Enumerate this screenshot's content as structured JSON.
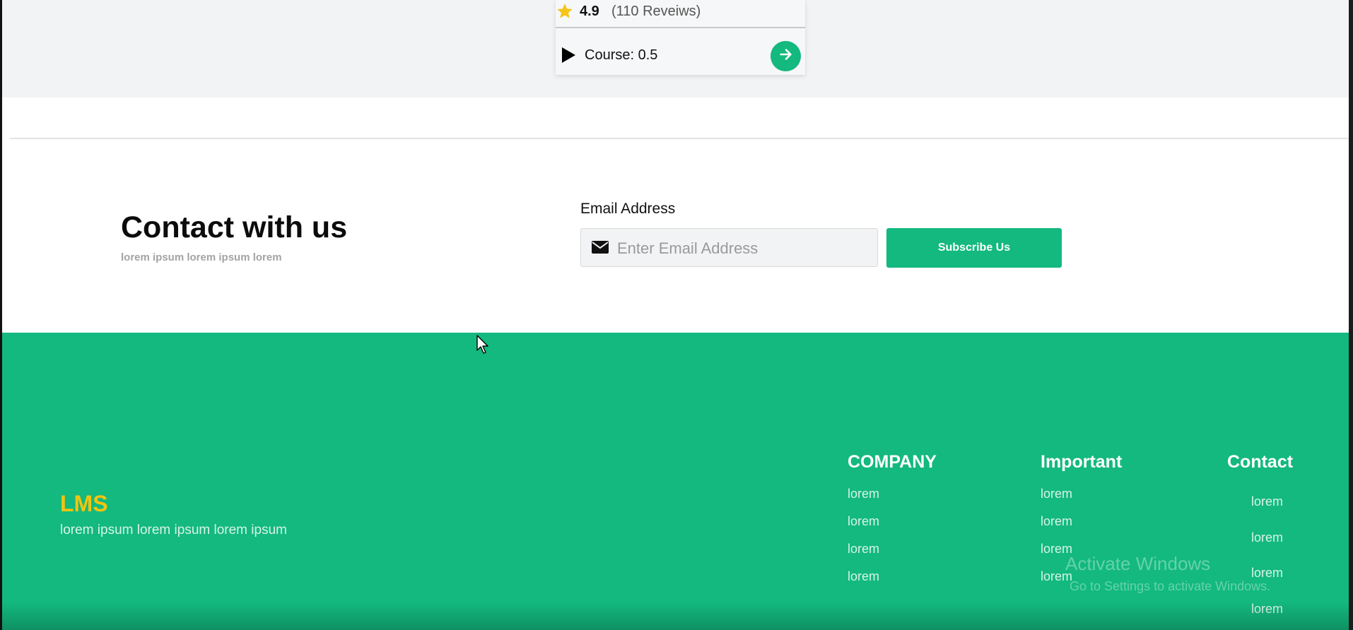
{
  "course_card": {
    "rating": "4.9",
    "reviews": "(110 Reveiws)",
    "course_label": "Course: 0.5",
    "icons": {
      "rating": "star-icon",
      "course": "play-icon",
      "action": "arrow-right-icon"
    }
  },
  "contact": {
    "title": "Contact with us",
    "subtitle": "lorem ipsum lorem ipsum lorem",
    "email_label": "Email Address",
    "email_placeholder": "Enter Email Address",
    "email_value": "",
    "subscribe_label": "Subscribe Us",
    "icons": {
      "email": "mail-icon"
    }
  },
  "footer": {
    "brand": "LMS",
    "tagline": "lorem ipsum lorem ipsum lorem ipsum",
    "columns": [
      {
        "heading": "COMPANY",
        "links": [
          "lorem",
          "lorem",
          "lorem",
          "lorem"
        ]
      },
      {
        "heading": "Important",
        "links": [
          "lorem",
          "lorem",
          "lorem",
          "lorem"
        ]
      },
      {
        "heading": "Contact",
        "links": [
          "lorem",
          "lorem",
          "lorem",
          "lorem"
        ]
      }
    ]
  },
  "overlay": {
    "activation_title": "Activate Windows",
    "activation_subtitle": "Go to Settings to activate Windows."
  },
  "colors": {
    "accent": "#13b97f",
    "brand": "#f2c40f",
    "star": "#f5c518",
    "background_gray": "#f2f3f5"
  }
}
